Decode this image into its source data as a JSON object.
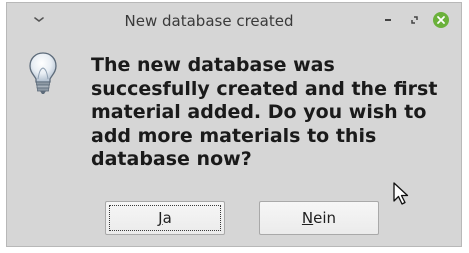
{
  "window": {
    "title": "New database created"
  },
  "titlebar_buttons": {
    "menu_icon": "chevron-down-icon",
    "minimize_icon": "minimize-icon",
    "maximize_icon": "maximize-icon",
    "close_icon": "close-icon",
    "close_color": "#6bb13b"
  },
  "dialog": {
    "icon": "lightbulb-icon",
    "message": "The new database was succesfully created and the first material added. Do you wish to add more materials to this database now?"
  },
  "buttons": {
    "yes": {
      "mnemonic": "J",
      "rest": "a"
    },
    "no": {
      "mnemonic": "N",
      "rest": "ein"
    }
  }
}
